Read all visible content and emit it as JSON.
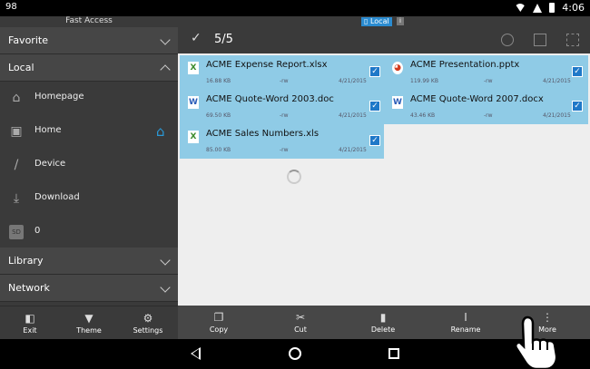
{
  "status_bar": {
    "left_text": "98",
    "time": "4:06"
  },
  "sidebar": {
    "header": "Fast Access",
    "sections": {
      "favorite": "Favorite",
      "local": "Local",
      "library": "Library",
      "network": "Network"
    },
    "local_items": [
      {
        "label": "Homepage",
        "icon": "home-outline-icon"
      },
      {
        "label": "Home",
        "icon": "folder-home-icon"
      },
      {
        "label": "Device",
        "icon": "slash-icon"
      },
      {
        "label": "Download",
        "icon": "download-icon"
      },
      {
        "label": "0",
        "icon": "sd-card-icon"
      }
    ],
    "bottom_buttons": [
      "Exit",
      "Theme",
      "Settings"
    ]
  },
  "location_chip": "Local",
  "toolbar": {
    "selection_count": "5/5"
  },
  "files": [
    {
      "name": "ACME Expense Report.xlsx",
      "size": "16.88 KB",
      "perm": "-rw",
      "date": "4/21/2015",
      "type": "X",
      "checked": true
    },
    {
      "name": "ACME Presentation.pptx",
      "size": "119.99 KB",
      "perm": "-rw",
      "date": "4/21/2015",
      "type": "P",
      "checked": true
    },
    {
      "name": "ACME Quote-Word 2003.doc",
      "size": "69.50 KB",
      "perm": "-rw",
      "date": "4/21/2015",
      "type": "W",
      "checked": true
    },
    {
      "name": "ACME Quote-Word 2007.docx",
      "size": "43.46 KB",
      "perm": "-rw",
      "date": "4/21/2015",
      "type": "W",
      "checked": true
    },
    {
      "name": "ACME Sales Numbers.xls",
      "size": "85.00 KB",
      "perm": "-rw",
      "date": "4/21/2015",
      "type": "X",
      "checked": true
    }
  ],
  "action_bar": [
    "Copy",
    "Cut",
    "Delete",
    "Rename",
    "More"
  ],
  "colors": {
    "accent": "#2a8bd0",
    "selection": "#8fcbe6",
    "checkbox": "#1f78c8"
  }
}
